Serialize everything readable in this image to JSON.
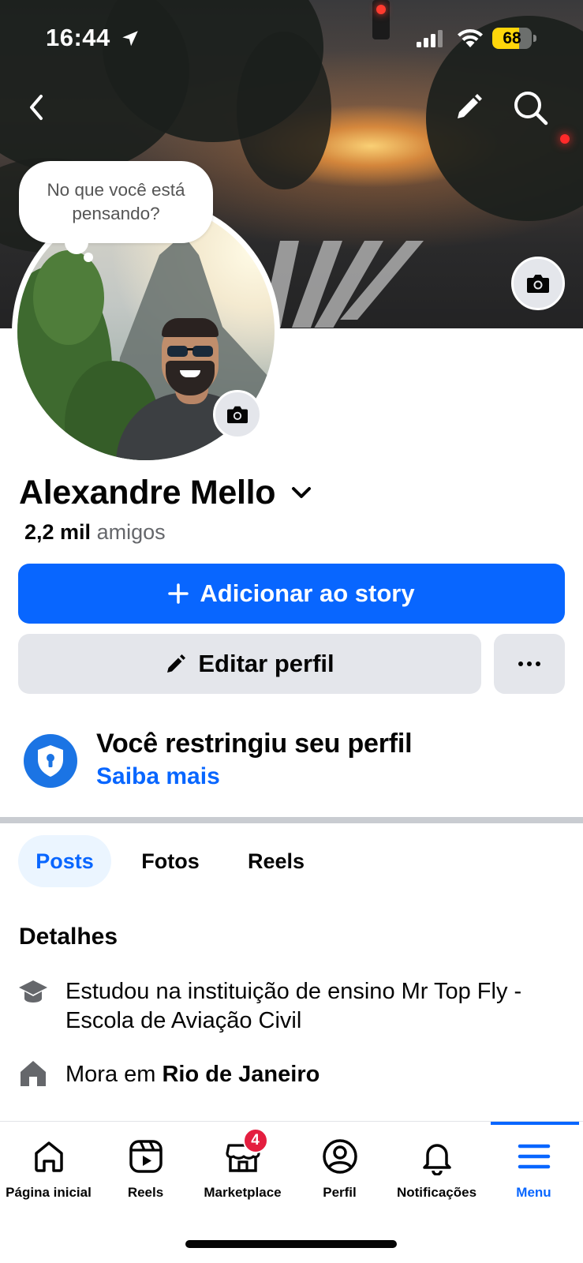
{
  "status_bar": {
    "time": "16:44",
    "battery": "68",
    "battery_level": 0.68
  },
  "cover": {
    "thought_bubble": "No que você está pensando?"
  },
  "profile": {
    "name": "Alexandre Mello",
    "friends_count": "2,2 mil",
    "friends_label": "amigos"
  },
  "actions": {
    "add_story": "Adicionar ao story",
    "edit_profile": "Editar perfil"
  },
  "restricted": {
    "title": "Você restringiu seu perfil",
    "link": "Saiba mais"
  },
  "tabs": [
    {
      "label": "Posts",
      "active": true
    },
    {
      "label": "Fotos",
      "active": false
    },
    {
      "label": "Reels",
      "active": false
    }
  ],
  "details": {
    "title": "Detalhes",
    "education": "Estudou na instituição de ensino Mr Top Fly - Escola de Aviação Civil",
    "lives_prefix": "Mora em",
    "lives_city": "Rio de Janeiro"
  },
  "bottom_nav": {
    "items": [
      {
        "label": "Página inicial",
        "icon": "home-icon"
      },
      {
        "label": "Reels",
        "icon": "reels-icon"
      },
      {
        "label": "Marketplace",
        "icon": "marketplace-icon",
        "badge": "4"
      },
      {
        "label": "Perfil",
        "icon": "profile-icon"
      },
      {
        "label": "Notificações",
        "icon": "bell-icon"
      },
      {
        "label": "Menu",
        "icon": "menu-icon",
        "active": true
      }
    ]
  },
  "colors": {
    "primary": "#0866ff",
    "secondary_button": "#e4e6eb",
    "badge": "#e41e3f",
    "shield": "#1b74e4",
    "battery": "#ffd60a"
  }
}
